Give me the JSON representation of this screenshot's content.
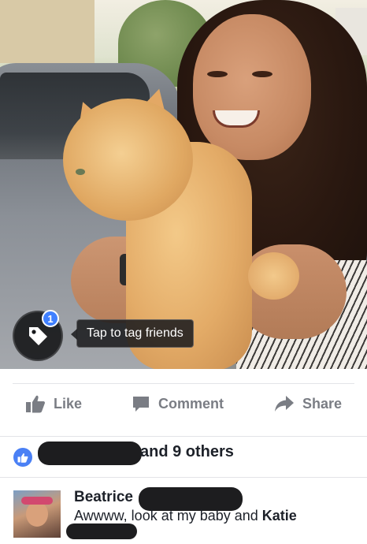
{
  "photo": {
    "tag_badge_count": "1",
    "tag_tooltip": "Tap to tag friends"
  },
  "actions": {
    "like_label": "Like",
    "comment_label": "Comment",
    "share_label": "Share"
  },
  "likes": {
    "others_text": "and 9 others"
  },
  "comment": {
    "author_first_name": "Beatrice",
    "text_prefix": "Awwww, look at my baby and ",
    "text_tagged": "Katie"
  },
  "colors": {
    "accent": "#4080ff",
    "like_blue": "#4a80f5",
    "action_gray": "#7a7d84",
    "text_dark": "#1d2129"
  }
}
